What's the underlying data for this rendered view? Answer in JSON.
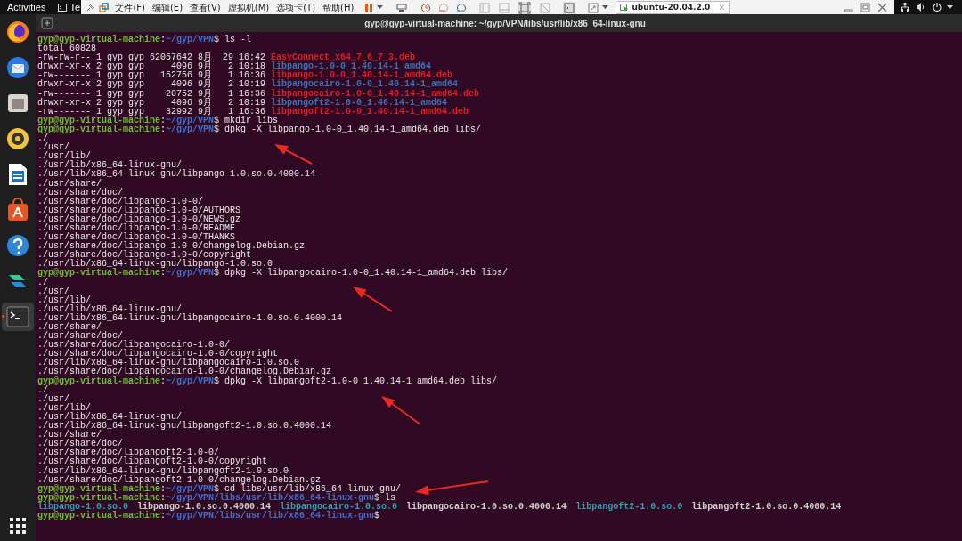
{
  "top_bar": {
    "activities": "Activities",
    "app_label": "Te"
  },
  "vm_toolbar": {
    "menus": [
      "文件(F)",
      "编辑(E)",
      "查看(V)",
      "虚拟机(M)",
      "选项卡(T)",
      "帮助(H)"
    ],
    "tab": {
      "title": "ubuntu-20.04.2.0",
      "close": "×",
      "selected": true
    }
  },
  "dock": [
    {
      "kind": "browser",
      "running": false
    },
    {
      "kind": "mail",
      "running": false
    },
    {
      "kind": "files",
      "running": false
    },
    {
      "kind": "music",
      "running": false
    },
    {
      "kind": "document",
      "running": false
    },
    {
      "kind": "store",
      "running": false
    },
    {
      "kind": "help",
      "running": false
    },
    {
      "kind": "app",
      "running": false
    },
    {
      "kind": "terminal",
      "running": true
    }
  ],
  "terminal": {
    "title": "gyp@gyp-virtual-machine: ~/gyp/VPN/libs/usr/lib/x86_64-linux-gnu",
    "lines": [
      {
        "kind": "prompt",
        "host": "gyp@gyp-virtual-machine",
        "sep": ":",
        "path": "~/gyp/VPN",
        "command": "$ ls -l"
      },
      {
        "kind": "output",
        "text": "total 60828"
      },
      {
        "kind": "ls",
        "info": "-rw-rw-r-- 1 gyp gyp 62057642 8月  29 16:42",
        "name": "EasyConnect_x64_7_6_7_3.deb",
        "color": "#e01b24"
      },
      {
        "kind": "ls",
        "info": "drwxr-xr-x 2 gyp gyp     4096 9月   2 10:18",
        "name": "libpango-1.0-0_1.40.14-1_amd64",
        "color": "#3f6fb5"
      },
      {
        "kind": "ls",
        "info": "-rw------- 1 gyp gyp   152756 9月   1 16:36",
        "name": "libpango-1.0-0_1.40.14-1_amd64.deb",
        "color": "#e01b24"
      },
      {
        "kind": "ls",
        "info": "drwxr-xr-x 2 gyp gyp     4096 9月   2 10:19",
        "name": "libpangocairo-1.0-0_1.40.14-1_amd64",
        "color": "#3f6fb5"
      },
      {
        "kind": "ls",
        "info": "-rw------- 1 gyp gyp    20752 9月   1 16:36",
        "name": "libpangocairo-1.0-0_1.40.14-1_amd64.deb",
        "color": "#e01b24"
      },
      {
        "kind": "ls",
        "info": "drwxr-xr-x 2 gyp gyp     4096 9月   2 10:19",
        "name": "libpangoft2-1.0-0_1.40.14-1_amd64",
        "color": "#3f6fb5"
      },
      {
        "kind": "ls",
        "info": "-rw------- 1 gyp gyp    32992 9月   1 16:36",
        "name": "libpangoft2-1.0-0_1.40.14-1_amd64.deb",
        "color": "#e01b24"
      },
      {
        "kind": "prompt",
        "host": "gyp@gyp-virtual-machine",
        "sep": ":",
        "path": "~/gyp/VPN",
        "command": "$ mkdir libs"
      },
      {
        "kind": "prompt",
        "host": "gyp@gyp-virtual-machine",
        "sep": ":",
        "path": "~/gyp/VPN",
        "command": "$ dpkg -X libpango-1.0-0_1.40.14-1_amd64.deb libs/"
      },
      {
        "kind": "output",
        "text": "./"
      },
      {
        "kind": "output",
        "text": "./usr/"
      },
      {
        "kind": "output",
        "text": "./usr/lib/"
      },
      {
        "kind": "output",
        "text": "./usr/lib/x86_64-linux-gnu/"
      },
      {
        "kind": "output",
        "text": "./usr/lib/x86_64-linux-gnu/libpango-1.0.so.0.4000.14"
      },
      {
        "kind": "output",
        "text": "./usr/share/"
      },
      {
        "kind": "output",
        "text": "./usr/share/doc/"
      },
      {
        "kind": "output",
        "text": "./usr/share/doc/libpango-1.0-0/"
      },
      {
        "kind": "output",
        "text": "./usr/share/doc/libpango-1.0-0/AUTHORS"
      },
      {
        "kind": "output",
        "text": "./usr/share/doc/libpango-1.0-0/NEWS.gz"
      },
      {
        "kind": "output",
        "text": "./usr/share/doc/libpango-1.0-0/README"
      },
      {
        "kind": "output",
        "text": "./usr/share/doc/libpango-1.0-0/THANKS"
      },
      {
        "kind": "output",
        "text": "./usr/share/doc/libpango-1.0-0/changelog.Debian.gz"
      },
      {
        "kind": "output",
        "text": "./usr/share/doc/libpango-1.0-0/copyright"
      },
      {
        "kind": "output",
        "text": "./usr/lib/x86_64-linux-gnu/libpango-1.0.so.0"
      },
      {
        "kind": "prompt",
        "host": "gyp@gyp-virtual-machine",
        "sep": ":",
        "path": "~/gyp/VPN",
        "command": "$ dpkg -X libpangocairo-1.0-0_1.40.14-1_amd64.deb libs/"
      },
      {
        "kind": "output",
        "text": "./"
      },
      {
        "kind": "output",
        "text": "./usr/"
      },
      {
        "kind": "output",
        "text": "./usr/lib/"
      },
      {
        "kind": "output",
        "text": "./usr/lib/x86_64-linux-gnu/"
      },
      {
        "kind": "output",
        "text": "./usr/lib/x86_64-linux-gnu/libpangocairo-1.0.so.0.4000.14"
      },
      {
        "kind": "output",
        "text": "./usr/share/"
      },
      {
        "kind": "output",
        "text": "./usr/share/doc/"
      },
      {
        "kind": "output",
        "text": "./usr/share/doc/libpangocairo-1.0-0/"
      },
      {
        "kind": "output",
        "text": "./usr/share/doc/libpangocairo-1.0-0/copyright"
      },
      {
        "kind": "output",
        "text": "./usr/lib/x86_64-linux-gnu/libpangocairo-1.0.so.0"
      },
      {
        "kind": "output",
        "text": "./usr/share/doc/libpangocairo-1.0-0/changelog.Debian.gz"
      },
      {
        "kind": "prompt",
        "host": "gyp@gyp-virtual-machine",
        "sep": ":",
        "path": "~/gyp/VPN",
        "command": "$ dpkg -X libpangoft2-1.0-0_1.40.14-1_amd64.deb libs/"
      },
      {
        "kind": "output",
        "text": "./"
      },
      {
        "kind": "output",
        "text": "./usr/"
      },
      {
        "kind": "output",
        "text": "./usr/lib/"
      },
      {
        "kind": "output",
        "text": "./usr/lib/x86_64-linux-gnu/"
      },
      {
        "kind": "output",
        "text": "./usr/lib/x86_64-linux-gnu/libpangoft2-1.0.so.0.4000.14"
      },
      {
        "kind": "output",
        "text": "./usr/share/"
      },
      {
        "kind": "output",
        "text": "./usr/share/doc/"
      },
      {
        "kind": "output",
        "text": "./usr/share/doc/libpangoft2-1.0-0/"
      },
      {
        "kind": "output",
        "text": "./usr/share/doc/libpangoft2-1.0-0/copyright"
      },
      {
        "kind": "output",
        "text": "./usr/lib/x86_64-linux-gnu/libpangoft2-1.0.so.0"
      },
      {
        "kind": "output",
        "text": "./usr/share/doc/libpangoft2-1.0-0/changelog.Debian.gz"
      },
      {
        "kind": "prompt",
        "host": "gyp@gyp-virtual-machine",
        "sep": ":",
        "path": "~/gyp/VPN",
        "command": "$ cd libs/usr/lib/x86_64-linux-gnu/"
      },
      {
        "kind": "prompt",
        "host": "gyp@gyp-virtual-machine",
        "sep": ":",
        "path": "~/gyp/VPN/libs/usr/lib/x86_64-linux-gnu",
        "command": "$ ls"
      },
      {
        "kind": "files",
        "files": [
          {
            "name": "libpango-1.0.so.0",
            "color": "#2aa1b3"
          },
          {
            "name": "libpango-1.0.so.0.4000.14",
            "color": "#d0cfcc"
          },
          {
            "name": "libpangocairo-1.0.so.0",
            "color": "#2aa1b3"
          },
          {
            "name": "libpangocairo-1.0.so.0.4000.14",
            "color": "#d0cfcc"
          },
          {
            "name": "libpangoft2-1.0.so.0",
            "color": "#2aa1b3"
          },
          {
            "name": "libpangoft2-1.0.so.0.4000.14",
            "color": "#d0cfcc"
          }
        ]
      },
      {
        "kind": "prompt",
        "host": "gyp@gyp-virtual-machine",
        "sep": ":",
        "path": "~/gyp/VPN/libs/usr/lib/x86_64-linux-gnu",
        "command": "$"
      }
    ]
  }
}
